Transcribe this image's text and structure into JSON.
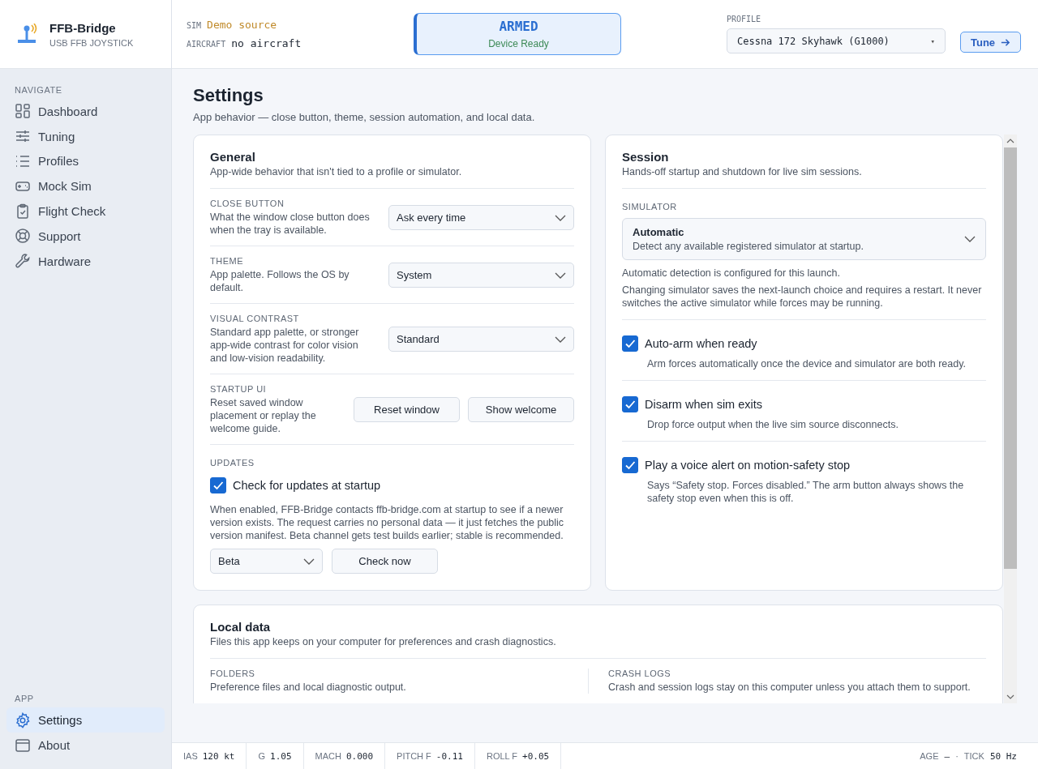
{
  "brand": {
    "name": "FFB-Bridge",
    "subtitle": "USB FFB JOYSTICK"
  },
  "source": [
    {
      "label": "SIM",
      "value": "Demo source",
      "kind": "live"
    },
    {
      "label": "AIRCRAFT",
      "value": "no aircraft",
      "kind": "plain"
    }
  ],
  "status": {
    "title": "ARMED",
    "detail": "Device Ready",
    "armed": true
  },
  "profile": {
    "label": "PROFILE",
    "value": "Cessna 172 Skyhawk (G1000)",
    "caret": "▾"
  },
  "tune_button": "Tune",
  "sidebar": [
    {
      "heading": "NAVIGATE",
      "items": [
        {
          "label": "Dashboard",
          "selected": false
        },
        {
          "label": "Tuning",
          "selected": false
        },
        {
          "label": "Profiles",
          "selected": false
        },
        {
          "label": "Mock Sim",
          "selected": false
        },
        {
          "label": "Flight Check",
          "selected": false
        },
        {
          "label": "Support",
          "selected": false
        },
        {
          "label": "Hardware",
          "selected": false
        }
      ]
    },
    {
      "heading": "APP",
      "items": [
        {
          "label": "Settings",
          "selected": true
        },
        {
          "label": "About",
          "selected": false
        }
      ]
    }
  ],
  "page": {
    "title": "Settings",
    "subtitle": "App behavior — close button, theme, session automation, and local data."
  },
  "general": {
    "title": "General",
    "subtitle": "App-wide behavior that isn't tied to a profile or simulator.",
    "rows": [
      {
        "kind": "select",
        "label": "CLOSE BUTTON",
        "description": "What the window close button does when the tray is available.",
        "value": "Ask every time"
      },
      {
        "kind": "select",
        "label": "THEME",
        "description": "App palette. Follows the OS by default.",
        "value": "System"
      },
      {
        "kind": "select",
        "label": "VISUAL CONTRAST",
        "description": "Standard app palette, or stronger app-wide contrast for color vision and low-vision readability.",
        "value": "Standard"
      },
      {
        "kind": "buttons",
        "label": "STARTUP UI",
        "description": "Reset saved window placement or replay the welcome guide.",
        "buttons": [
          "Reset window",
          "Show welcome"
        ]
      }
    ],
    "updates": {
      "label": "UPDATES",
      "checkbox": {
        "label": "Check for updates at startup",
        "checked": true
      },
      "description": "When enabled, FFB-Bridge contacts ffb-bridge.com at startup to see if a newer version exists. The request carries no personal data — it just fetches the public version manifest. Beta channel gets test builds earlier; stable is recommended.",
      "channel": "Beta",
      "button": "Check now"
    }
  },
  "session": {
    "title": "Session",
    "subtitle": "Hands-off startup and shutdown for live sim sessions.",
    "simulator": {
      "label": "SIMULATOR",
      "value": "Automatic",
      "description": "Detect any available registered simulator at startup."
    },
    "notes": [
      "Automatic detection is configured for this launch.",
      "Changing simulator saves the next-launch choice and requires a restart. It never switches the active simulator while forces may be running."
    ],
    "options": [
      {
        "label": "Auto-arm when ready",
        "checked": true,
        "description": "Arm forces automatically once the device and simulator are both ready."
      },
      {
        "label": "Disarm when sim exits",
        "checked": true,
        "description": "Drop force output when the live sim source disconnects."
      },
      {
        "label": "Play a voice alert on motion-safety stop",
        "checked": true,
        "description": "Says “Safety stop. Forces disabled.” The arm button always shows the safety stop even when this is off."
      }
    ]
  },
  "local_data": {
    "title": "Local data",
    "subtitle": "Files this app keeps on your computer for preferences and crash diagnostics.",
    "columns": [
      {
        "label": "FOLDERS",
        "description": "Preference files and local diagnostic output."
      },
      {
        "label": "CRASH LOGS",
        "description": "Crash and session logs stay on this computer unless you attach them to support."
      }
    ]
  },
  "status_bar": {
    "readouts": [
      {
        "label": "IAS",
        "value": "120 kt"
      },
      {
        "label": "G",
        "value": "1.05"
      },
      {
        "label": "MACH",
        "value": "0.000"
      },
      {
        "label": "PITCH F",
        "value": "-0.11"
      },
      {
        "label": "ROLL F",
        "value": "+0.05"
      }
    ],
    "right": [
      {
        "label": "AGE",
        "value": "—"
      },
      {
        "label": "TICK",
        "value": "50 Hz"
      }
    ],
    "separator": "·"
  }
}
